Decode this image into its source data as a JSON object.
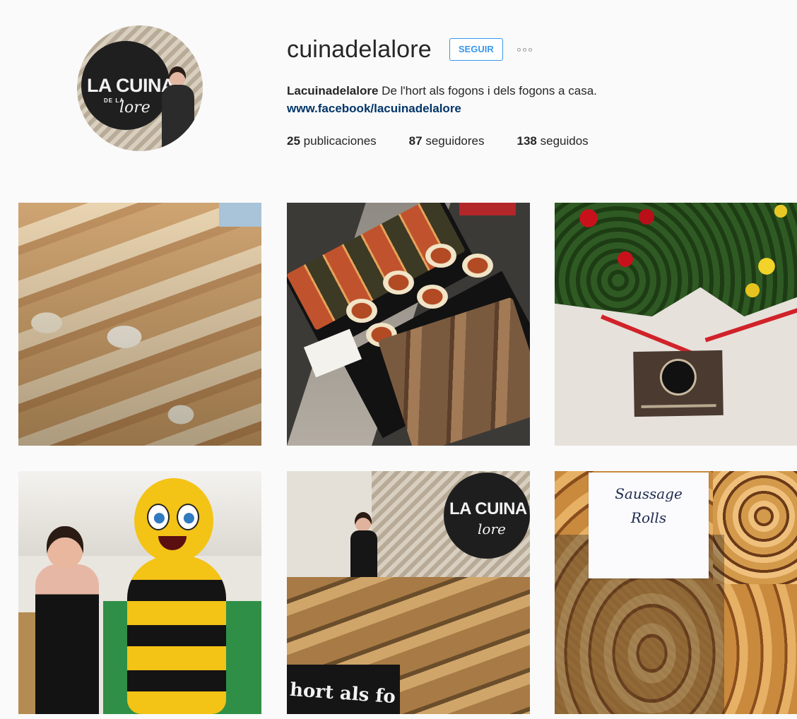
{
  "profile": {
    "username": "cuinadelalore",
    "follow_label": "SEGUIR",
    "options_label": "···",
    "avatar_logo": {
      "line1": "LA CUINA",
      "line2": "DE LA",
      "line3": "lore"
    },
    "bio_name": "Lacuinadelalore",
    "bio_text": "De l'hort als fogons i dels fogons a casa.",
    "bio_link": "www.facebook/lacuinadelalore"
  },
  "stats": [
    {
      "count": "25",
      "label": "publicaciones"
    },
    {
      "count": "87",
      "label": "seguidores"
    },
    {
      "count": "138",
      "label": "seguidos"
    }
  ],
  "posts": [
    {
      "subject": "sugared pastry rolls"
    },
    {
      "subject": "pizzas and tarts on black trays"
    },
    {
      "subject": "red and yellow roses with business card"
    },
    {
      "subject": "woman with bee mascot"
    },
    {
      "subject": "market stand with pastries",
      "sign_line1": "LA CUINA",
      "sign_line3": "lore",
      "banner_text": "hort als fo"
    },
    {
      "subject": "sausage rolls in basket",
      "sign_line1": "Saussage",
      "sign_line2": "Rolls"
    }
  ],
  "colors": {
    "background": "#fafafa",
    "text": "#262626",
    "follow_blue": "#3897f0",
    "link_blue": "#003569"
  }
}
